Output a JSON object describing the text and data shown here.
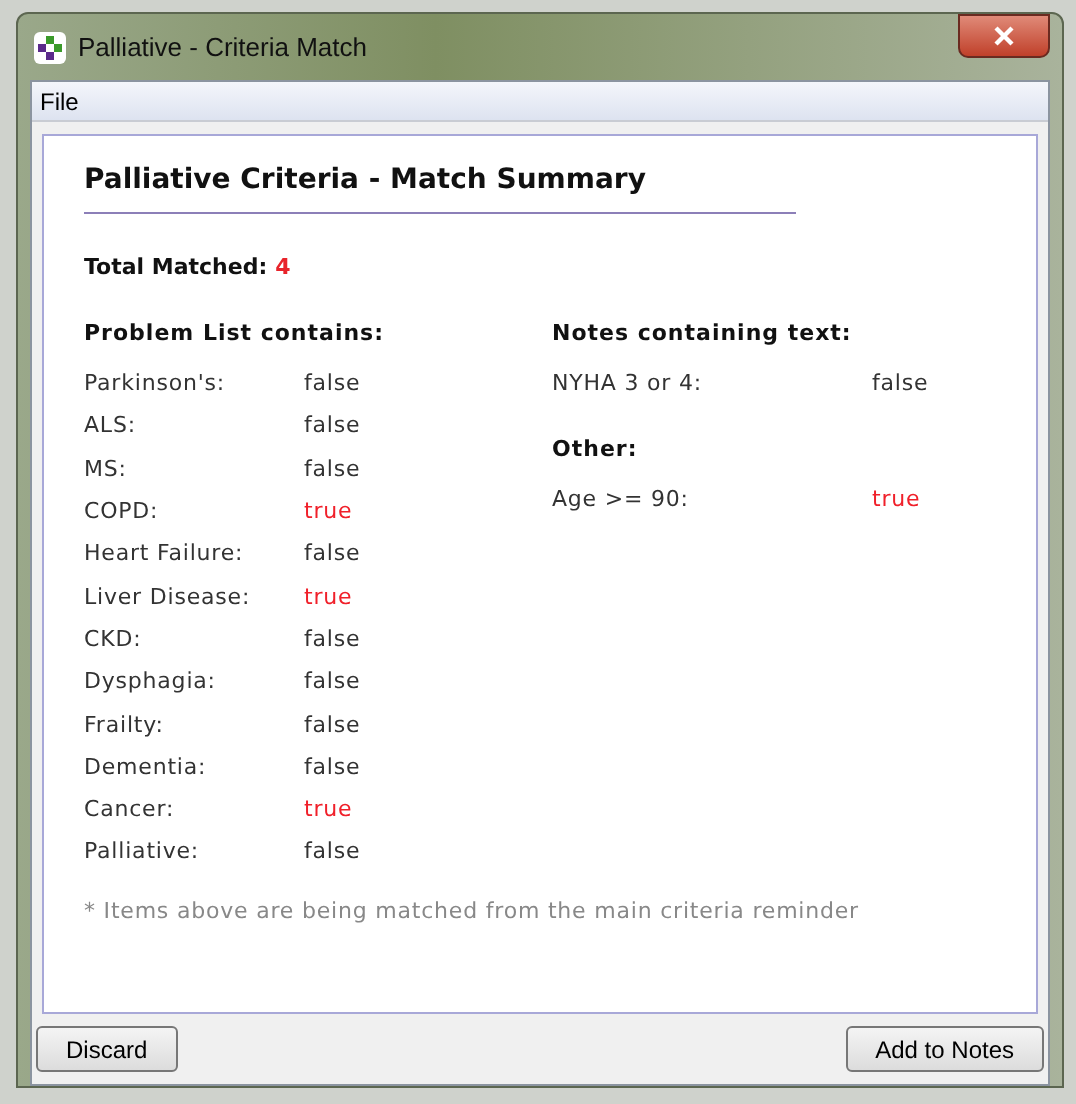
{
  "window": {
    "title": "Palliative - Criteria Match"
  },
  "menu": [
    "File"
  ],
  "summary": {
    "title": "Palliative Criteria - Match Summary",
    "total_label": "Total Matched:",
    "total_value": "4",
    "problem_list": {
      "heading": "Problem List contains:",
      "items": [
        {
          "label": "Parkinson's:",
          "value": "false",
          "matched": false
        },
        {
          "label": "ALS:",
          "value": "false",
          "matched": false
        },
        {
          "label": "MS:",
          "value": "false",
          "matched": false
        },
        {
          "label": "COPD:",
          "value": "true",
          "matched": true
        },
        {
          "label": "Heart Failure:",
          "value": "false",
          "matched": false
        },
        {
          "label": "Liver Disease:",
          "value": "true",
          "matched": true
        },
        {
          "label": "CKD:",
          "value": "false",
          "matched": false
        },
        {
          "label": "Dysphagia:",
          "value": "false",
          "matched": false
        },
        {
          "label": "Frailty:",
          "value": "false",
          "matched": false
        },
        {
          "label": "Dementia:",
          "value": "false",
          "matched": false
        },
        {
          "label": "Cancer:",
          "value": "true",
          "matched": true
        },
        {
          "label": "Palliative:",
          "value": "false",
          "matched": false
        }
      ]
    },
    "notes": {
      "heading": "Notes containing text:",
      "items": [
        {
          "label": "NYHA 3 or 4:",
          "value": "false",
          "matched": false
        }
      ]
    },
    "other": {
      "heading": "Other:",
      "items": [
        {
          "label": "Age >= 90:",
          "value": "true",
          "matched": true
        }
      ]
    },
    "footnote": "* Items above are being matched from the main criteria reminder"
  },
  "buttons": [
    "Discard",
    "Add to Notes"
  ]
}
